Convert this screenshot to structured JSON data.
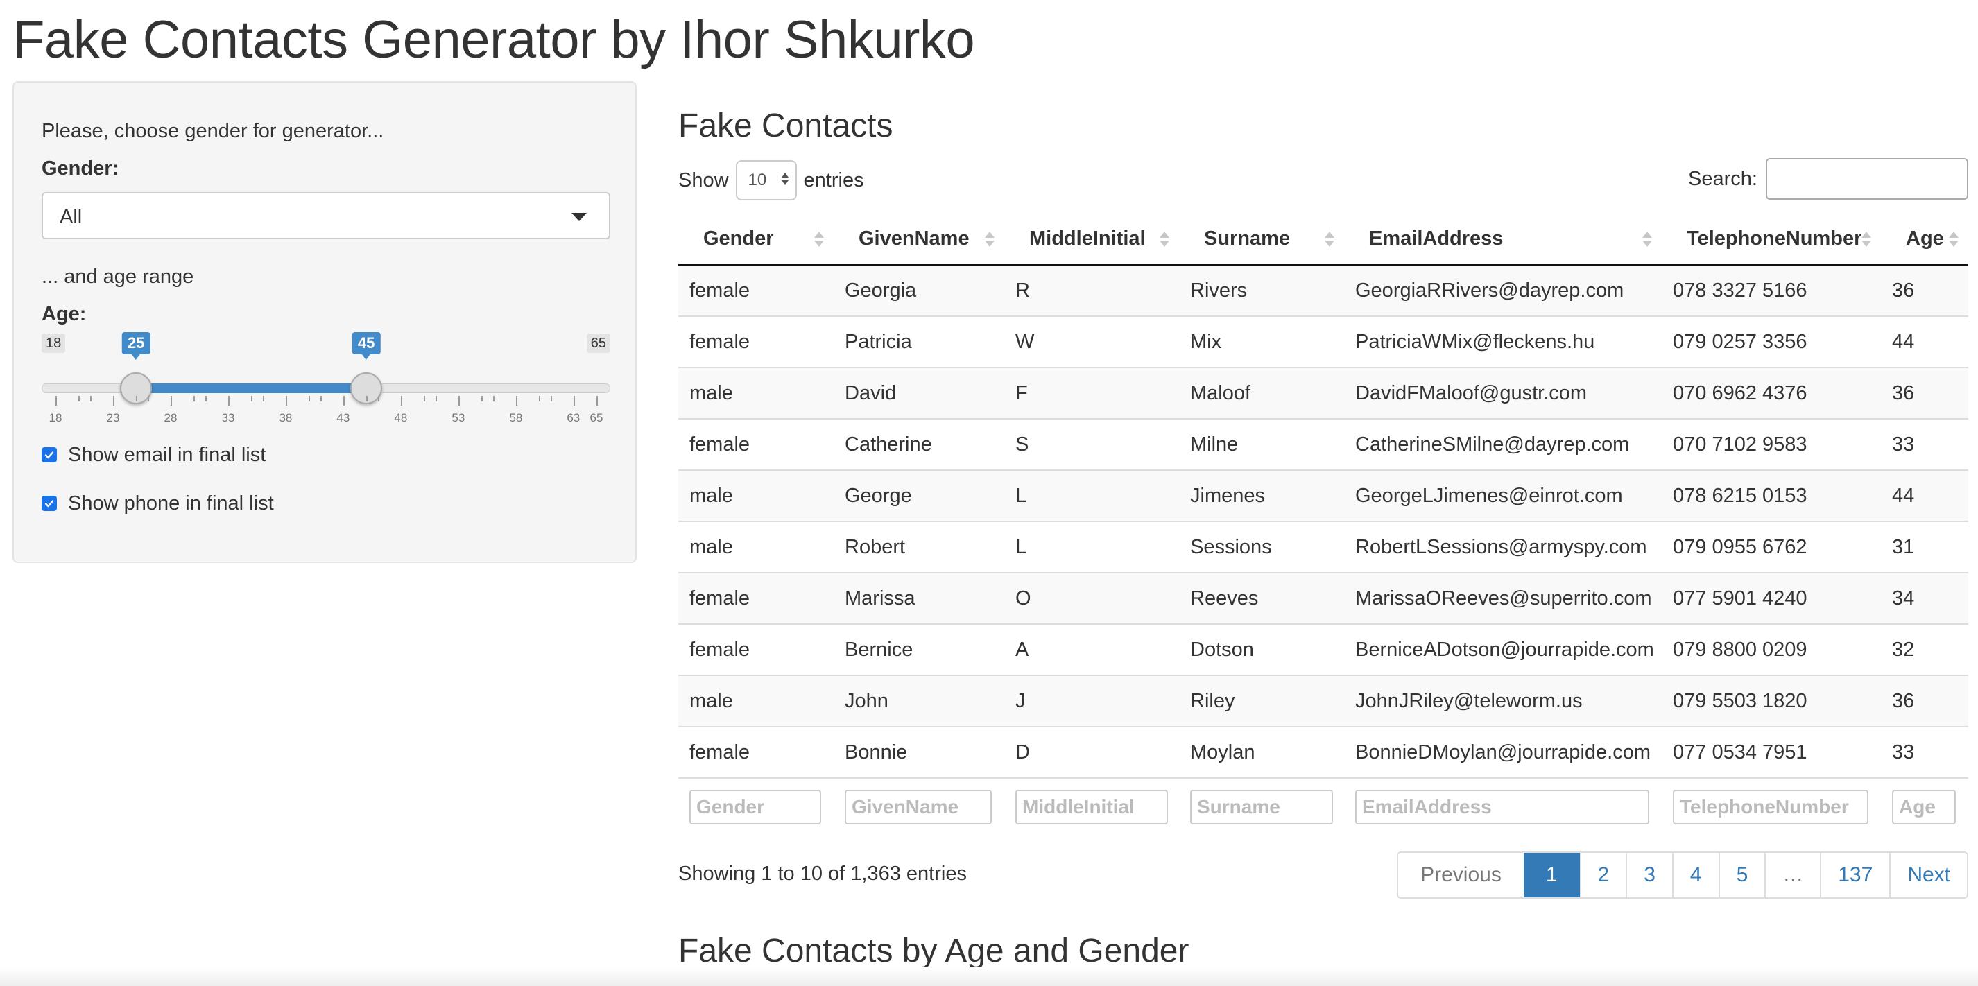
{
  "app": {
    "title": "Fake Contacts Generator by Ihor Shkurko"
  },
  "sidebar": {
    "intro": "Please, choose gender for generator...",
    "gender_label": "Gender:",
    "gender_value": "All",
    "age_intro": "... and age range",
    "age_label": "Age:",
    "age_min": 18,
    "age_max": 65,
    "age_from": 25,
    "age_to": 45,
    "min_label": "18",
    "max_label": "65",
    "from_label": "25",
    "to_label": "45",
    "ticks": [
      "18",
      "23",
      "28",
      "33",
      "38",
      "43",
      "48",
      "53",
      "58",
      "63",
      "65"
    ],
    "show_email_label": "Show email in final list",
    "show_email_checked": true,
    "show_phone_label": "Show phone in final list",
    "show_phone_checked": true
  },
  "main": {
    "table_title": "Fake Contacts",
    "show_label": "Show",
    "page_length": "10",
    "entries_label": "entries",
    "search_label": "Search:",
    "search_value": "",
    "columns": [
      "Gender",
      "GivenName",
      "MiddleInitial",
      "Surname",
      "EmailAddress",
      "TelephoneNumber",
      "Age"
    ],
    "rows": [
      [
        "female",
        "Georgia",
        "R",
        "Rivers",
        "GeorgiaRRivers@dayrep.com",
        "078 3327 5166",
        "36"
      ],
      [
        "female",
        "Patricia",
        "W",
        "Mix",
        "PatriciaWMix@fleckens.hu",
        "079 0257 3356",
        "44"
      ],
      [
        "male",
        "David",
        "F",
        "Maloof",
        "DavidFMaloof@gustr.com",
        "070 6962 4376",
        "36"
      ],
      [
        "female",
        "Catherine",
        "S",
        "Milne",
        "CatherineSMilne@dayrep.com",
        "070 7102 9583",
        "33"
      ],
      [
        "male",
        "George",
        "L",
        "Jimenes",
        "GeorgeLJimenes@einrot.com",
        "078 6215 0153",
        "44"
      ],
      [
        "male",
        "Robert",
        "L",
        "Sessions",
        "RobertLSessions@armyspy.com",
        "079 0955 6762",
        "31"
      ],
      [
        "female",
        "Marissa",
        "O",
        "Reeves",
        "MarissaOReeves@superrito.com",
        "077 5901 4240",
        "34"
      ],
      [
        "female",
        "Bernice",
        "A",
        "Dotson",
        "BerniceADotson@jourrapide.com",
        "079 8800 0209",
        "32"
      ],
      [
        "male",
        "John",
        "J",
        "Riley",
        "JohnJRiley@teleworm.us",
        "079 5503 1820",
        "36"
      ],
      [
        "female",
        "Bonnie",
        "D",
        "Moylan",
        "BonnieDMoylan@jourrapide.com",
        "077 0534 7951",
        "33"
      ]
    ],
    "filter_placeholders": [
      "Gender",
      "GivenName",
      "MiddleInitial",
      "Surname",
      "EmailAddress",
      "TelephoneNumber",
      "Age"
    ],
    "info": "Showing 1 to 10 of 1,363 entries",
    "pagination": {
      "previous": "Previous",
      "pages": [
        "1",
        "2",
        "3",
        "4",
        "5",
        "…",
        "137"
      ],
      "active": "1",
      "next": "Next"
    },
    "chart_title": "Fake Contacts by Age and Gender"
  },
  "colors": {
    "accent": "#428bca",
    "link": "#337ab7",
    "checkbox": "#1a73e8"
  }
}
